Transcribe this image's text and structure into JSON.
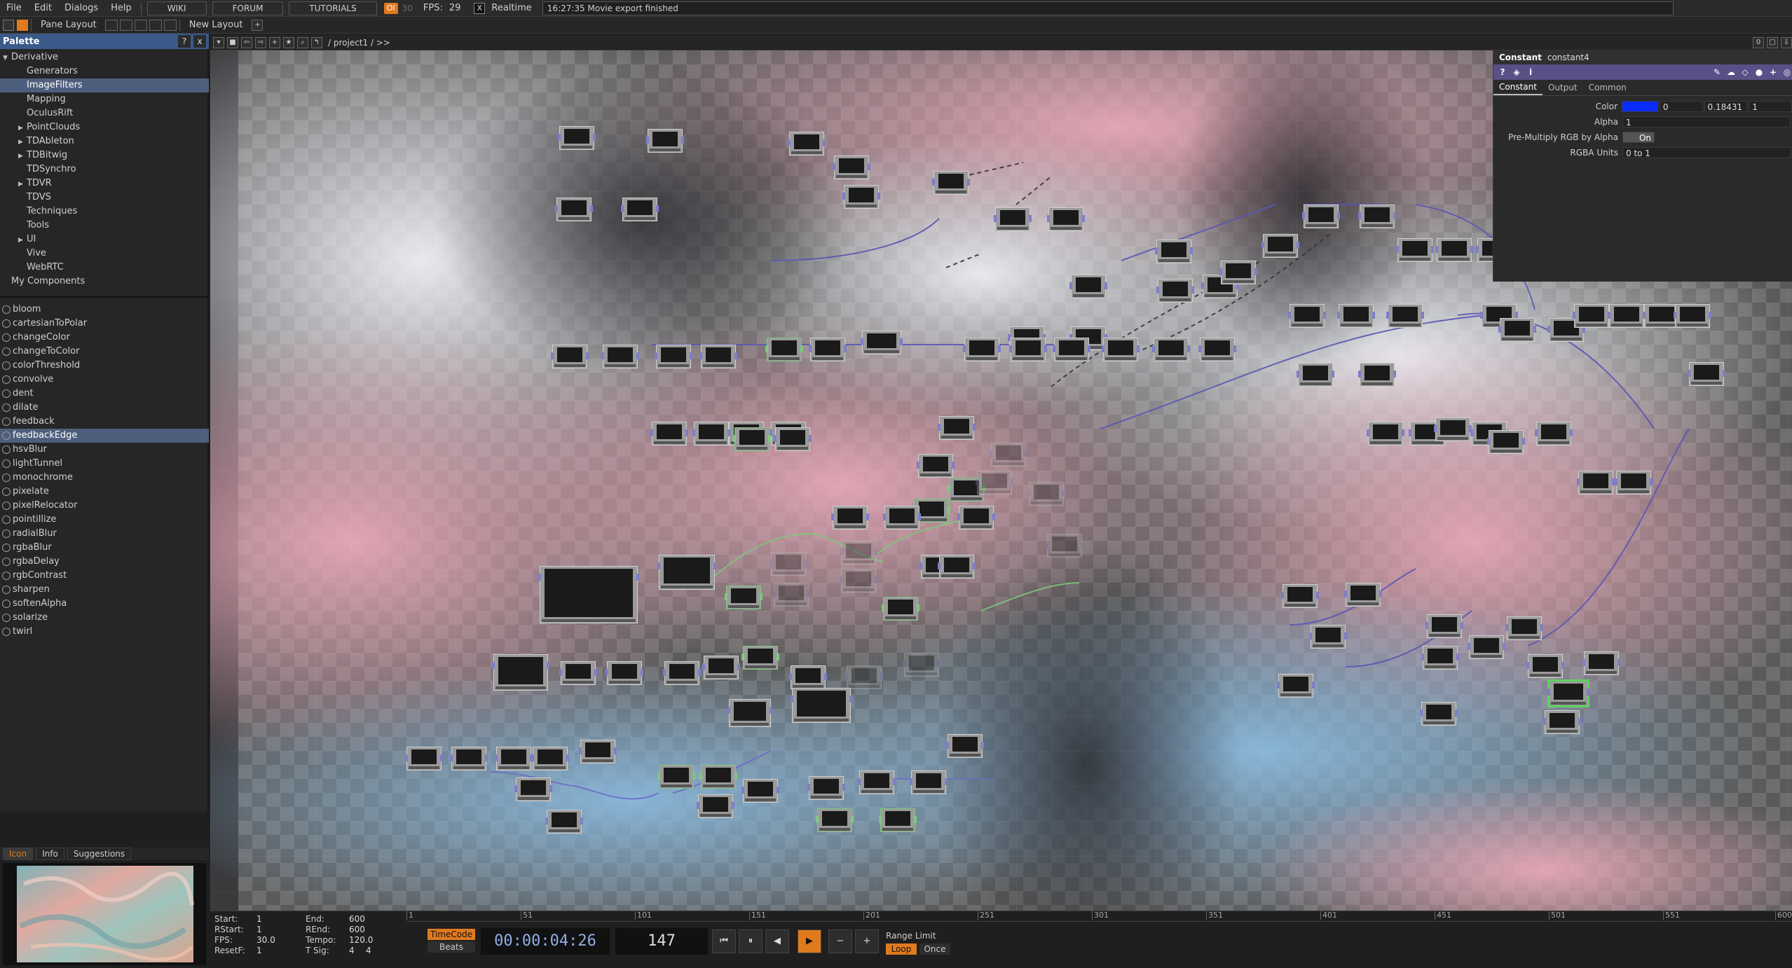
{
  "menu": {
    "items": [
      "File",
      "Edit",
      "Dialogs",
      "Help"
    ],
    "wiki": "WIKI",
    "forum": "FORUM",
    "tutorials": "TUTORIALS",
    "perf_label": "OI",
    "dim_value": "30",
    "fps_label": "FPS:",
    "fps_value": "29",
    "realtime_check": "X",
    "realtime_label": "Realtime",
    "status": "16:27:35 Movie export finished"
  },
  "layoutbar": {
    "pane_layout": "Pane Layout",
    "new_layout": "New Layout",
    "plus": "+"
  },
  "palette": {
    "title": "Palette",
    "help": "?",
    "close": "x",
    "tree": [
      {
        "label": "Derivative",
        "arrow": "▼",
        "indent": 0
      },
      {
        "label": "Generators",
        "arrow": "",
        "indent": 1
      },
      {
        "label": "ImageFilters",
        "arrow": "",
        "indent": 1,
        "selected": true
      },
      {
        "label": "Mapping",
        "arrow": "",
        "indent": 1
      },
      {
        "label": "OculusRift",
        "arrow": "",
        "indent": 1
      },
      {
        "label": "PointClouds",
        "arrow": "▶",
        "indent": 1
      },
      {
        "label": "TDAbleton",
        "arrow": "▶",
        "indent": 1
      },
      {
        "label": "TDBitwig",
        "arrow": "▶",
        "indent": 1
      },
      {
        "label": "TDSynchro",
        "arrow": "",
        "indent": 1
      },
      {
        "label": "TDVR",
        "arrow": "▶",
        "indent": 1
      },
      {
        "label": "TDVS",
        "arrow": "",
        "indent": 1
      },
      {
        "label": "Techniques",
        "arrow": "",
        "indent": 1
      },
      {
        "label": "Tools",
        "arrow": "",
        "indent": 1
      },
      {
        "label": "UI",
        "arrow": "▶",
        "indent": 1
      },
      {
        "label": "Vive",
        "arrow": "",
        "indent": 1
      },
      {
        "label": "WebRTC",
        "arrow": "",
        "indent": 1
      },
      {
        "label": "My Components",
        "arrow": "",
        "indent": 0
      }
    ],
    "components": [
      "bloom",
      "cartesianToPolar",
      "changeColor",
      "changeToColor",
      "colorThreshold",
      "convolve",
      "dent",
      "dilate",
      "feedback",
      "feedbackEdge",
      "hsvBlur",
      "lightTunnel",
      "monochrome",
      "pixelate",
      "pixelRelocator",
      "pointillize",
      "radialBlur",
      "rgbaBlur",
      "rgbaDelay",
      "rgbContrast",
      "sharpen",
      "softenAlpha",
      "solarize",
      "twirl"
    ],
    "selected_component": "feedbackEdge",
    "tabs": [
      "Icon",
      "Info",
      "Suggestions"
    ]
  },
  "network": {
    "path": "/ project1 / >>",
    "counter": "0"
  },
  "params": {
    "op_type": "Constant",
    "op_name": "constant4",
    "tabs": [
      "Constant",
      "Output",
      "Common"
    ],
    "color_label": "Color",
    "color_swatch": "#0a2cff",
    "color_r": "0",
    "color_g": "0.18431",
    "color_b": "1",
    "alpha_label": "Alpha",
    "alpha_value": "1",
    "premult_label": "Pre-Multiply RGB by Alpha",
    "premult_value": "On",
    "rgba_units_label": "RGBA Units",
    "rgba_units_value": "0 to 1"
  },
  "timeline": {
    "start_label": "Start:",
    "start_value": "1",
    "rstart_label": "RStart:",
    "rstart_value": "1",
    "fps_label": "FPS:",
    "fps_value": "30.0",
    "resetf_label": "ResetF:",
    "resetf_value": "1",
    "end_label": "End:",
    "end_value": "600",
    "rend_label": "REnd:",
    "rend_value": "600",
    "tempo_label": "Tempo:",
    "tempo_value": "120.0",
    "tsig_label": "T Sig:",
    "tsig_a": "4",
    "tsig_b": "4",
    "ruler": [
      "1",
      "51",
      "101",
      "151",
      "201",
      "251",
      "301",
      "351",
      "401",
      "451",
      "501",
      "551",
      "600"
    ],
    "timecode_btn": "TimeCode",
    "beats_btn": "Beats",
    "timecode": "00:00:04:26",
    "frame": "147",
    "range_limit": "Range Limit",
    "loop": "Loop",
    "once": "Once"
  }
}
